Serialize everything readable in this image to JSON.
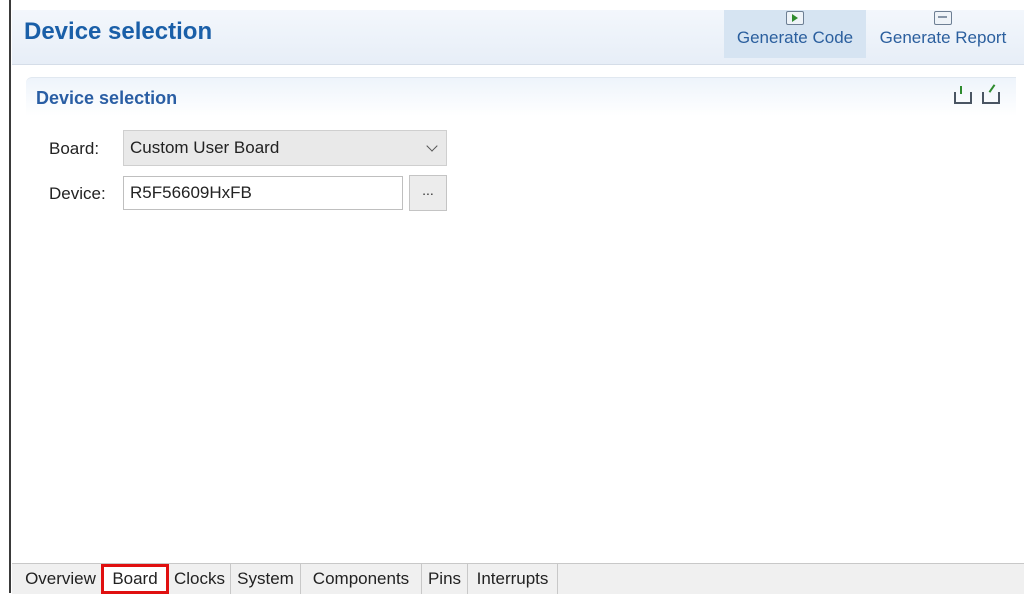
{
  "header": {
    "title": "Device selection",
    "generate_code": {
      "label": "Generate Code",
      "icon": "generate-code-icon"
    },
    "generate_report": {
      "label": "Generate Report",
      "icon": "generate-report-icon"
    }
  },
  "section": {
    "title": "Device selection",
    "icons": [
      "import-icon",
      "export-icon"
    ]
  },
  "form": {
    "board_label": "Board:",
    "board_value": "Custom User Board",
    "device_label": "Device:",
    "device_value": "R5F56609HxFB",
    "browse_label": "..."
  },
  "tabs": [
    {
      "label": "Overview"
    },
    {
      "label": "Board",
      "highlighted": true
    },
    {
      "label": "Clocks"
    },
    {
      "label": "System"
    },
    {
      "label": "Components"
    },
    {
      "label": "Pins"
    },
    {
      "label": "Interrupts"
    }
  ],
  "colors": {
    "title_blue": "#1a5fa8",
    "highlight_red": "#e01010"
  }
}
